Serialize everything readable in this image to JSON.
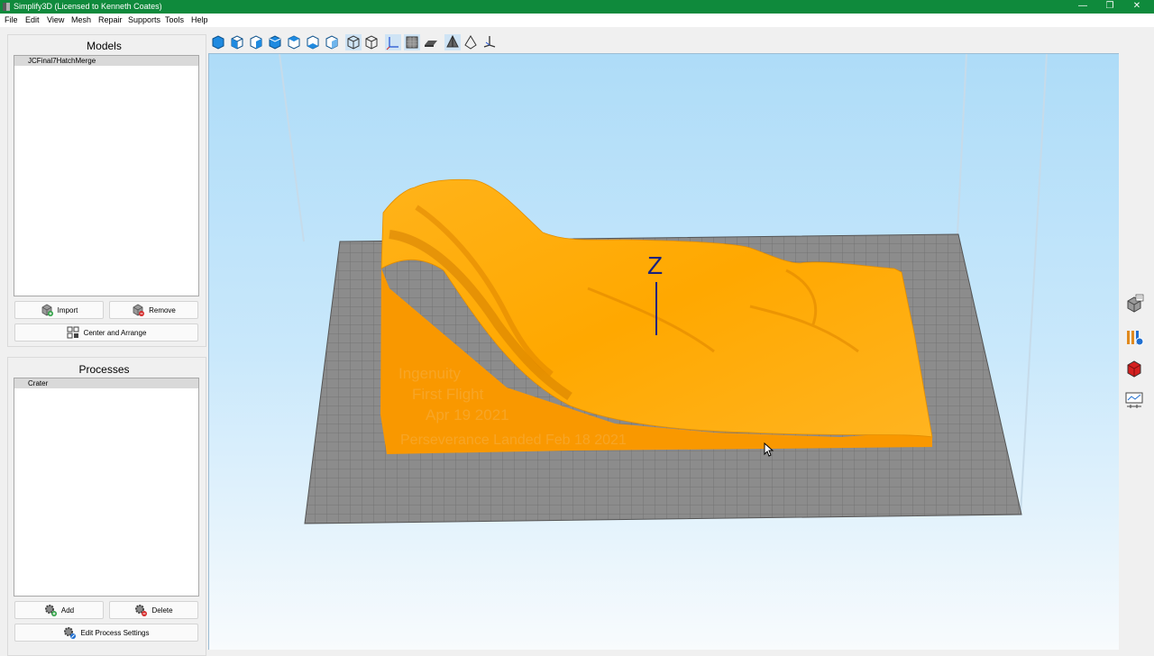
{
  "window": {
    "title": "Simplify3D (Licensed to Kenneth Coates)"
  },
  "menu": {
    "items": [
      "File",
      "Edit",
      "View",
      "Mesh",
      "Repair",
      "Supports",
      "Tools",
      "Help"
    ]
  },
  "models": {
    "title": "Models",
    "items": [
      "JCFinal7HatchMerge"
    ],
    "import_label": "Import",
    "remove_label": "Remove",
    "center_label": "Center and Arrange"
  },
  "processes": {
    "title": "Processes",
    "items": [
      "Crater"
    ],
    "add_label": "Add",
    "delete_label": "Delete",
    "edit_label": "Edit Process Settings"
  },
  "viewport": {
    "axis_label": "Z",
    "model_text": [
      "Ingenuity",
      "First Flight",
      "Apr 19 2021",
      "Perseverance Landed Feb 18 2021"
    ],
    "colors": {
      "model_top": "#ffac00",
      "model_side": "#f99800",
      "bed": "#8a8a8a",
      "sky": "#aedcf8"
    }
  },
  "toolbar": {
    "icons": [
      "view-default-icon",
      "view-front-icon",
      "view-back-icon",
      "view-left-icon",
      "view-right-icon",
      "view-top-icon",
      "view-bottom-icon",
      "isometric-cube-icon",
      "wireframe-cube-icon",
      "axes-icon",
      "build-volume-icon",
      "bed-icon",
      "shaded-prism-icon",
      "outline-prism-icon",
      "ruler-icon"
    ]
  },
  "sidebar_right": {
    "icons": [
      "print-settings-icon",
      "cross-section-icon",
      "material-cube-icon",
      "preview-icon"
    ]
  }
}
